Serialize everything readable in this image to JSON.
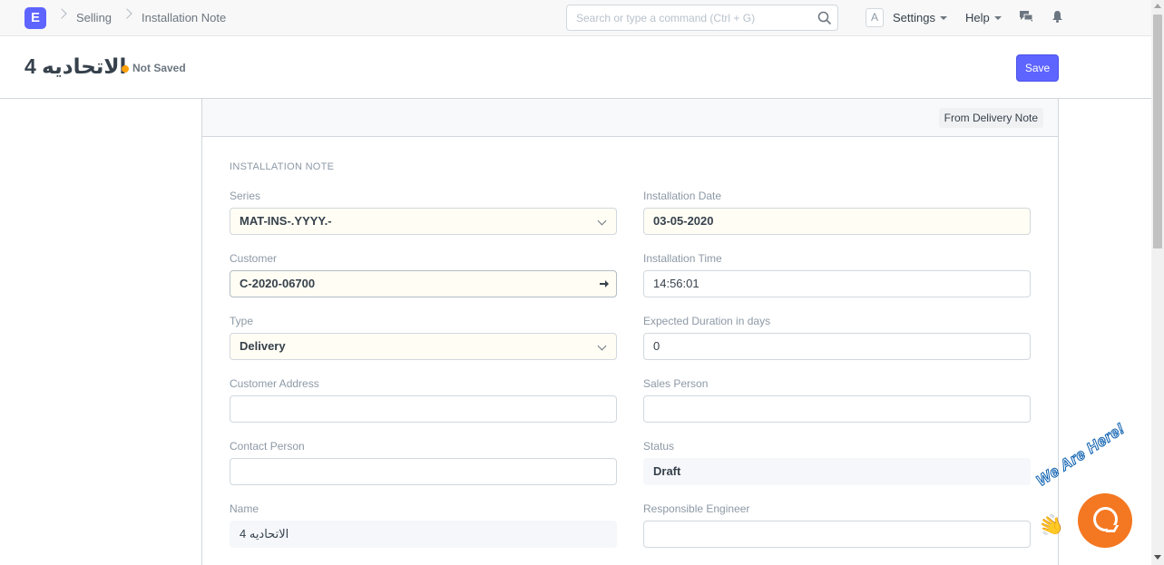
{
  "navbar": {
    "logo": "E",
    "breadcrumbs": [
      "Selling",
      "Installation Note"
    ],
    "search_placeholder": "Search or type a command (Ctrl + G)",
    "avatar": "A",
    "settings_label": "Settings",
    "help_label": "Help"
  },
  "page": {
    "title": "الاتحاديه 4",
    "indicator": "Not Saved",
    "indicator_color": "#ffa00a",
    "save_label": "Save"
  },
  "toolbar": {
    "from_delivery_note": "From Delivery Note"
  },
  "form": {
    "section_title": "INSTALLATION NOTE",
    "left": [
      {
        "label": "Series",
        "value": "MAT-INS-.YYYY.-",
        "kind": "select"
      },
      {
        "label": "Customer",
        "value": "C-2020-06700",
        "kind": "link"
      },
      {
        "label": "Type",
        "value": "Delivery",
        "kind": "select"
      },
      {
        "label": "Customer Address",
        "value": "",
        "kind": "input"
      },
      {
        "label": "Contact Person",
        "value": "",
        "kind": "input"
      },
      {
        "label": "Name",
        "value": "الاتحاديه 4",
        "kind": "readonly"
      }
    ],
    "right": [
      {
        "label": "Installation Date",
        "value": "03-05-2020",
        "kind": "date"
      },
      {
        "label": "Installation Time",
        "value": "14:56:01",
        "kind": "input"
      },
      {
        "label": "Expected Duration in days",
        "value": "0",
        "kind": "input"
      },
      {
        "label": "Sales Person",
        "value": "",
        "kind": "input"
      },
      {
        "label": "Status",
        "value": "Draft",
        "kind": "readonly"
      },
      {
        "label": "Responsible Engineer",
        "value": "",
        "kind": "input"
      }
    ]
  },
  "chat_widget": {
    "tagline": "We Are Here!",
    "accent_color": "#f47721"
  },
  "colors": {
    "primary": "#5e64ff",
    "navbar_bg": "#f8f8f8",
    "border": "#d1d8dd"
  }
}
